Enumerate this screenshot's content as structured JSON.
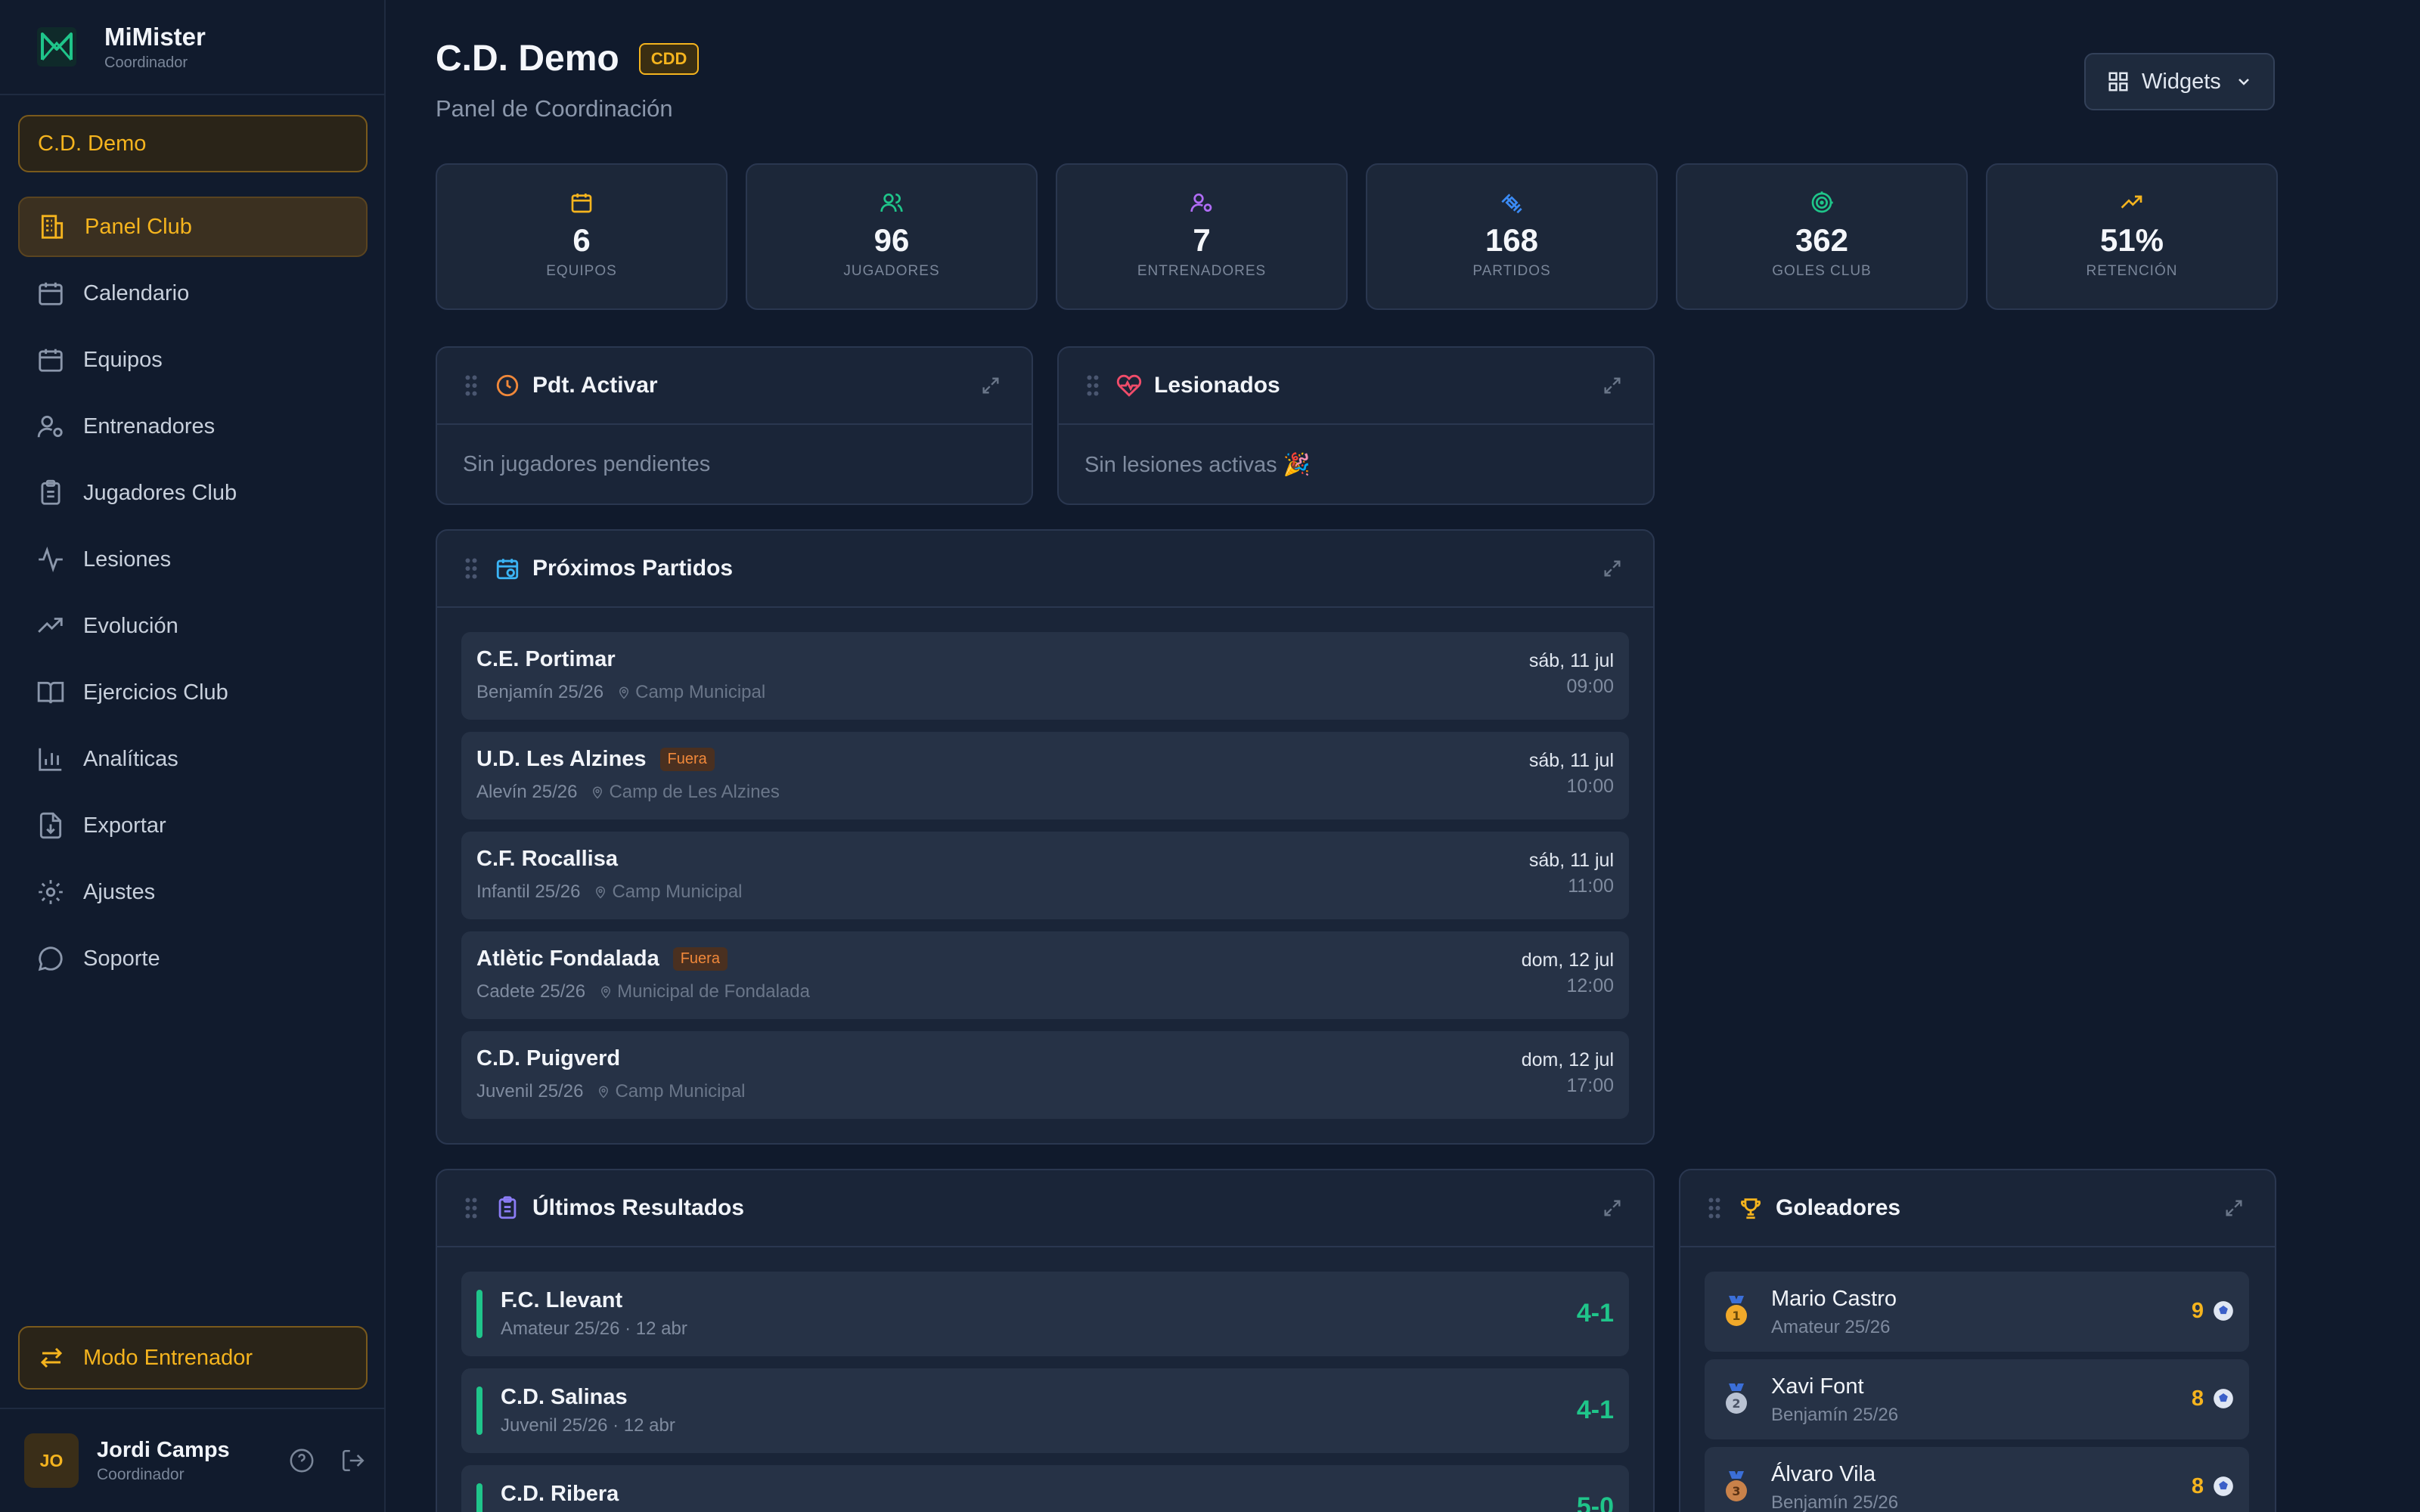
{
  "brand": {
    "name": "MiMister",
    "role": "Coordinador"
  },
  "club_selector": {
    "label": "C.D. Demo"
  },
  "nav": [
    {
      "label": "Panel Club",
      "icon": "building-icon",
      "active": true
    },
    {
      "label": "Calendario",
      "icon": "calendar-icon"
    },
    {
      "label": "Equipos",
      "icon": "calendar-icon"
    },
    {
      "label": "Entrenadores",
      "icon": "user-cog-icon"
    },
    {
      "label": "Jugadores Club",
      "icon": "clipboard-icon"
    },
    {
      "label": "Lesiones",
      "icon": "activity-icon"
    },
    {
      "label": "Evolución",
      "icon": "trending-up-icon"
    },
    {
      "label": "Ejercicios Club",
      "icon": "book-icon"
    },
    {
      "label": "Analíticas",
      "icon": "bar-chart-icon"
    },
    {
      "label": "Exportar",
      "icon": "file-download-icon"
    },
    {
      "label": "Ajustes",
      "icon": "gear-icon"
    },
    {
      "label": "Soporte",
      "icon": "chat-icon"
    }
  ],
  "coach_mode": {
    "label": "Modo Entrenador"
  },
  "user": {
    "initials": "JO",
    "name": "Jordi Camps",
    "role": "Coordinador"
  },
  "header": {
    "title": "C.D. Demo",
    "badge": "CDD",
    "subtitle": "Panel de Coordinación",
    "widgets_label": "Widgets"
  },
  "stats": [
    {
      "value": "6",
      "label": "EQUIPOS",
      "color": "#f5b41e"
    },
    {
      "value": "96",
      "label": "JUGADORES",
      "color": "#1fc58a"
    },
    {
      "value": "7",
      "label": "ENTRENADORES",
      "color": "#b06cf5"
    },
    {
      "value": "168",
      "label": "PARTIDOS",
      "color": "#3b8bf5"
    },
    {
      "value": "362",
      "label": "GOLES CLUB",
      "color": "#1fc58a"
    },
    {
      "value": "51%",
      "label": "RETENCIÓN",
      "color": "#f5b41e"
    }
  ],
  "pending": {
    "title": "Pdt. Activar",
    "empty": "Sin jugadores pendientes"
  },
  "injured": {
    "title": "Lesionados",
    "empty": "Sin lesiones activas 🎉"
  },
  "upcoming": {
    "title": "Próximos Partidos",
    "away_label": "Fuera",
    "matches": [
      {
        "team": "C.E. Portimar",
        "category": "Benjamín 25/26",
        "venue": "Camp Municipal",
        "date": "sáb, 11 jul",
        "time": "09:00",
        "away": false
      },
      {
        "team": "U.D. Les Alzines",
        "category": "Alevín 25/26",
        "venue": "Camp de Les Alzines",
        "date": "sáb, 11 jul",
        "time": "10:00",
        "away": true
      },
      {
        "team": "C.F. Rocallisa",
        "category": "Infantil 25/26",
        "venue": "Camp Municipal",
        "date": "sáb, 11 jul",
        "time": "11:00",
        "away": false
      },
      {
        "team": "Atlètic Fondalada",
        "category": "Cadete 25/26",
        "venue": "Municipal de Fondalada",
        "date": "dom, 12 jul",
        "time": "12:00",
        "away": true
      },
      {
        "team": "C.D. Puigverd",
        "category": "Juvenil 25/26",
        "venue": "Camp Municipal",
        "date": "dom, 12 jul",
        "time": "17:00",
        "away": false
      }
    ]
  },
  "results": {
    "title": "Últimos Resultados",
    "items": [
      {
        "team": "F.C. Llevant",
        "meta": "Amateur 25/26 · 12 abr",
        "score": "4-1"
      },
      {
        "team": "C.D. Salinas",
        "meta": "Juvenil 25/26 · 12 abr",
        "score": "4-1"
      },
      {
        "team": "C.D. Ribera",
        "meta": "",
        "score": "5-0"
      }
    ]
  },
  "scorers": {
    "title": "Goleadores",
    "items": [
      {
        "name": "Mario Castro",
        "team": "Amateur 25/26",
        "goals": "9",
        "rank": "1"
      },
      {
        "name": "Xavi Font",
        "team": "Benjamín 25/26",
        "goals": "8",
        "rank": "2"
      },
      {
        "name": "Álvaro Vila",
        "team": "Benjamín 25/26",
        "goals": "8",
        "rank": "3"
      }
    ]
  }
}
